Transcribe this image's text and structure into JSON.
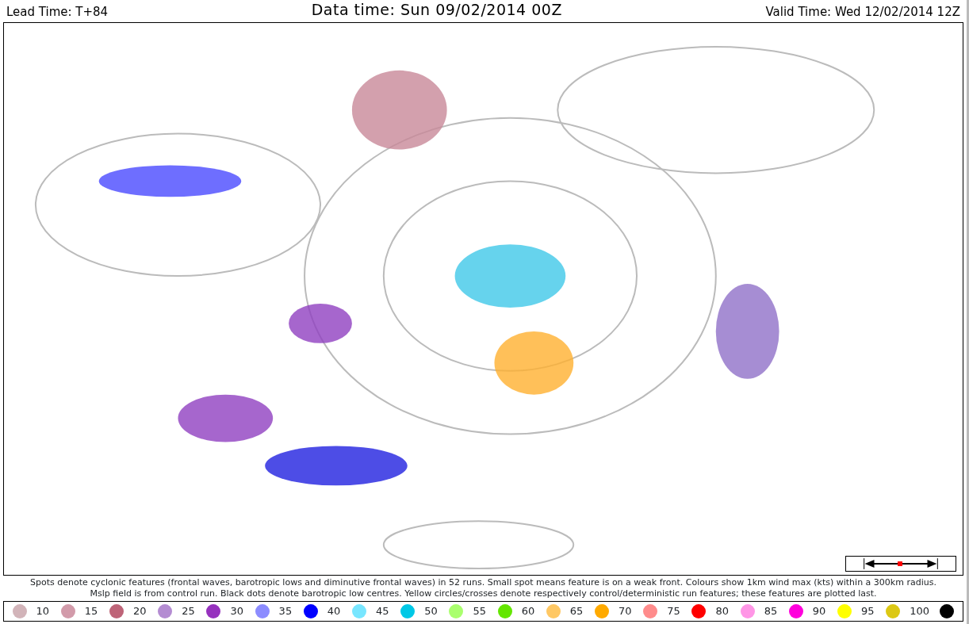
{
  "header": {
    "lead_time": "Lead Time: T+84",
    "data_time": "Data time:  Sun 09/02/2014 00Z",
    "valid_time": "Valid Time: Wed 12/02/2014 12Z"
  },
  "caption": [
    "Spots denote cyclonic features (frontal waves, barotropic lows and diminutive frontal waves) in 52 runs. Small spot means feature is on a weak front. Colours show 1km wind max (kts) within a 300km radius.",
    "Mslp field is from control run. Black dots denote barotropic low centres. Yellow circles/crosses denote respectively control/deterministic run features; these features are plotted last."
  ],
  "legend": [
    {
      "label": "10",
      "color": "#d2b4b9"
    },
    {
      "label": "15",
      "color": "#d29baa"
    },
    {
      "label": "20",
      "color": "#be6478"
    },
    {
      "label": "25",
      "color": "#b48cd2"
    },
    {
      "label": "30",
      "color": "#9632be"
    },
    {
      "label": "35",
      "color": "#8c8cff"
    },
    {
      "label": "40",
      "color": "#0000ff"
    },
    {
      "label": "45",
      "color": "#78e6ff"
    },
    {
      "label": "50",
      "color": "#00c8e6"
    },
    {
      "label": "55",
      "color": "#aaff6e"
    },
    {
      "label": "60",
      "color": "#64e600"
    },
    {
      "label": "65",
      "color": "#ffc864"
    },
    {
      "label": "70",
      "color": "#ffaa00"
    },
    {
      "label": "75",
      "color": "#ff8c8c"
    },
    {
      "label": "80",
      "color": "#ff0000"
    },
    {
      "label": "85",
      "color": "#ff96e6"
    },
    {
      "label": "90",
      "color": "#ff00dc"
    },
    {
      "label": "95",
      "color": "#ffff00"
    },
    {
      "label": "100",
      "color": "#dcc814"
    },
    {
      "color": "#000000"
    }
  ]
}
